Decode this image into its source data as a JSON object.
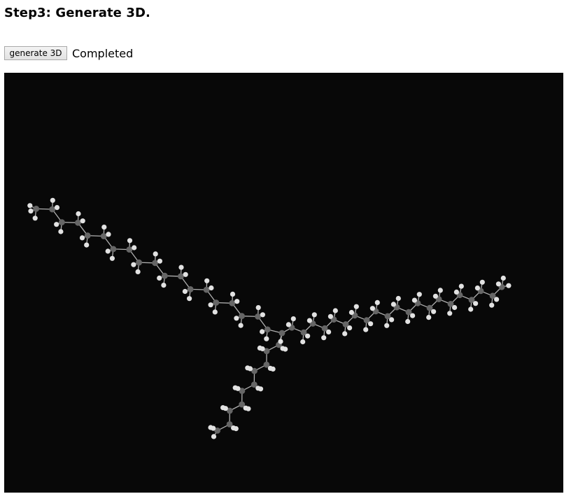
{
  "step": {
    "title": "Step3: Generate 3D."
  },
  "controls": {
    "generate_button_label": "generate 3D",
    "status_text": "Completed"
  },
  "viewer": {
    "background_color": "#080808",
    "carbon_color": "#666666",
    "hydrogen_color": "#e2e2e2",
    "bond_color": "#b0b0b0"
  }
}
